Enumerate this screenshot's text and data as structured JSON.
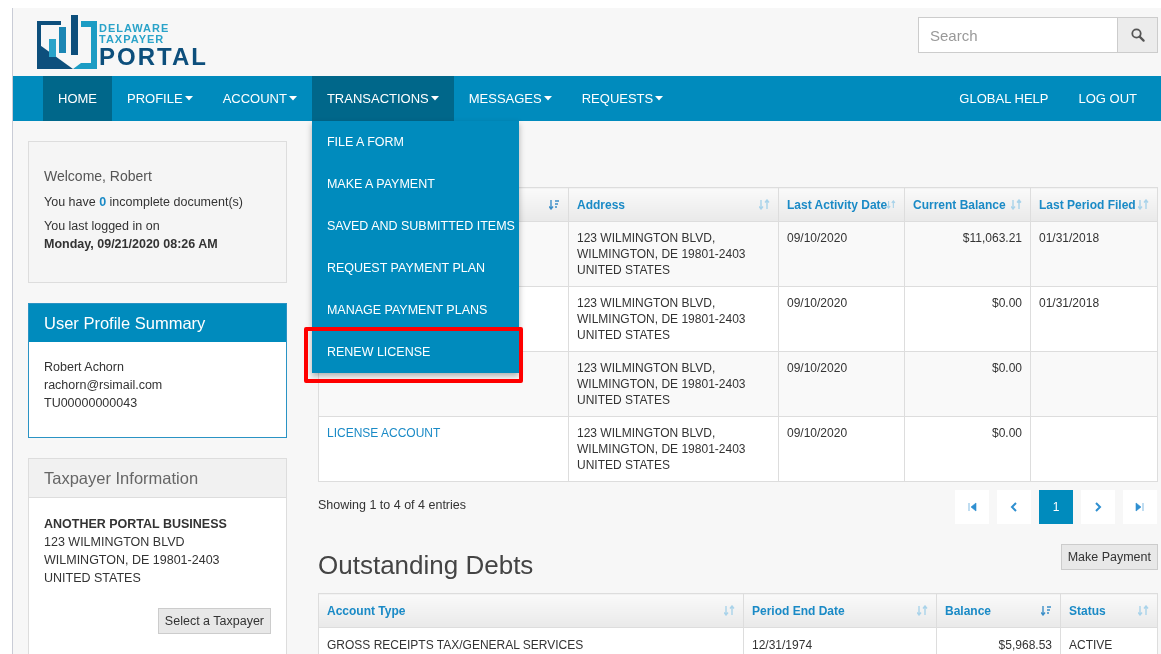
{
  "logo": {
    "lines": [
      "DELAWARE",
      "TAXPAYER",
      "PORTAL"
    ]
  },
  "search": {
    "placeholder": "Search"
  },
  "nav": {
    "items": [
      {
        "label": "HOME",
        "selected": true,
        "open": false,
        "caret": false
      },
      {
        "label": "PROFILE",
        "selected": false,
        "open": false,
        "caret": true
      },
      {
        "label": "ACCOUNT",
        "selected": false,
        "open": false,
        "caret": true
      },
      {
        "label": "TRANSACTIONS",
        "selected": false,
        "open": true,
        "caret": true,
        "menu": [
          {
            "label": "FILE A FORM",
            "highlighted": false
          },
          {
            "label": "MAKE A PAYMENT",
            "highlighted": false
          },
          {
            "label": "SAVED AND SUBMITTED ITEMS",
            "highlighted": false
          },
          {
            "label": "REQUEST PAYMENT PLAN",
            "highlighted": false
          },
          {
            "label": "MANAGE PAYMENT PLANS",
            "highlighted": false
          },
          {
            "label": "RENEW LICENSE",
            "highlighted": true
          }
        ]
      },
      {
        "label": "MESSAGES",
        "selected": false,
        "open": false,
        "caret": true
      },
      {
        "label": "REQUESTS",
        "selected": false,
        "open": false,
        "caret": true
      }
    ],
    "right": [
      "GLOBAL HELP",
      "LOG OUT"
    ]
  },
  "welcome": {
    "greeting": "Welcome, Robert",
    "documents": "You have **0** incomplete document(s)",
    "last_login_label": "You last logged in on",
    "last_login": "Monday, 09/21/2020 08:26 AM"
  },
  "profile": {
    "title": "User Profile Summary",
    "lines": [
      "Robert Achorn",
      "rachorn@rsimail.com",
      "TU00000000043"
    ]
  },
  "taxpayer": {
    "title": "Taxpayer Information",
    "name": "ANOTHER PORTAL BUSINESS",
    "lines": [
      "123 WILMINGTON BLVD",
      "WILMINGTON, DE 19801-2403",
      "UNITED STATES"
    ],
    "button": "Select a Taxpayer"
  },
  "accounts": {
    "columns": [
      {
        "sorted": true
      },
      {
        "label": "Address",
        "sorted": false
      },
      {
        "label": "Last Activity Date",
        "sorted": false
      },
      {
        "label": "Current Balance",
        "sorted": false
      },
      {
        "label": "Last Period Filed",
        "sorted": false
      }
    ],
    "rows": [
      {
        "address": [
          "123 WILMINGTON BLVD,",
          "WILMINGTON, DE 19801-2403",
          "UNITED STATES"
        ],
        "last_activity": "09/10/2020",
        "balance": "$11,063.21",
        "last_filed": "01/31/2018"
      },
      {
        "address": [
          "123 WILMINGTON BLVD,",
          "WILMINGTON, DE 19801-2403",
          "UNITED STATES"
        ],
        "last_activity": "09/10/2020",
        "balance": "$0.00",
        "last_filed": "01/31/2018"
      },
      {
        "address": [
          "123 WILMINGTON BLVD,",
          "WILMINGTON, DE 19801-2403",
          "UNITED STATES"
        ],
        "last_activity": "09/10/2020",
        "balance": "$0.00"
      },
      {
        "column_1": "LICENSE ACCOUNT",
        "address": [
          "123 WILMINGTON BLVD,",
          "WILMINGTON, DE 19801-2403",
          "UNITED STATES"
        ],
        "last_activity": "09/10/2020",
        "balance": "$0.00"
      }
    ],
    "info": "Showing 1 to 4 of 4 entries",
    "pager": [
      {
        "kind": "first",
        "selected": false
      },
      {
        "kind": "prev",
        "selected": false
      },
      {
        "kind": "page",
        "label": "1",
        "selected": true
      },
      {
        "kind": "next",
        "selected": false
      },
      {
        "kind": "last",
        "selected": false
      }
    ]
  },
  "debts": {
    "title": "Outstanding Debts",
    "button": "Make Payment",
    "columns": [
      {
        "label": "Account Type",
        "sorted": false
      },
      {
        "label": "Period End Date",
        "sorted": false
      },
      {
        "label": "Balance",
        "sorted": true
      },
      {
        "label": "Status",
        "sorted": false
      }
    ],
    "rows": [
      {
        "account_type": "GROSS RECEIPTS TAX/GENERAL SERVICES",
        "period_end": "12/31/1974",
        "balance": "$5,968.53",
        "status": "ACTIVE"
      }
    ]
  }
}
